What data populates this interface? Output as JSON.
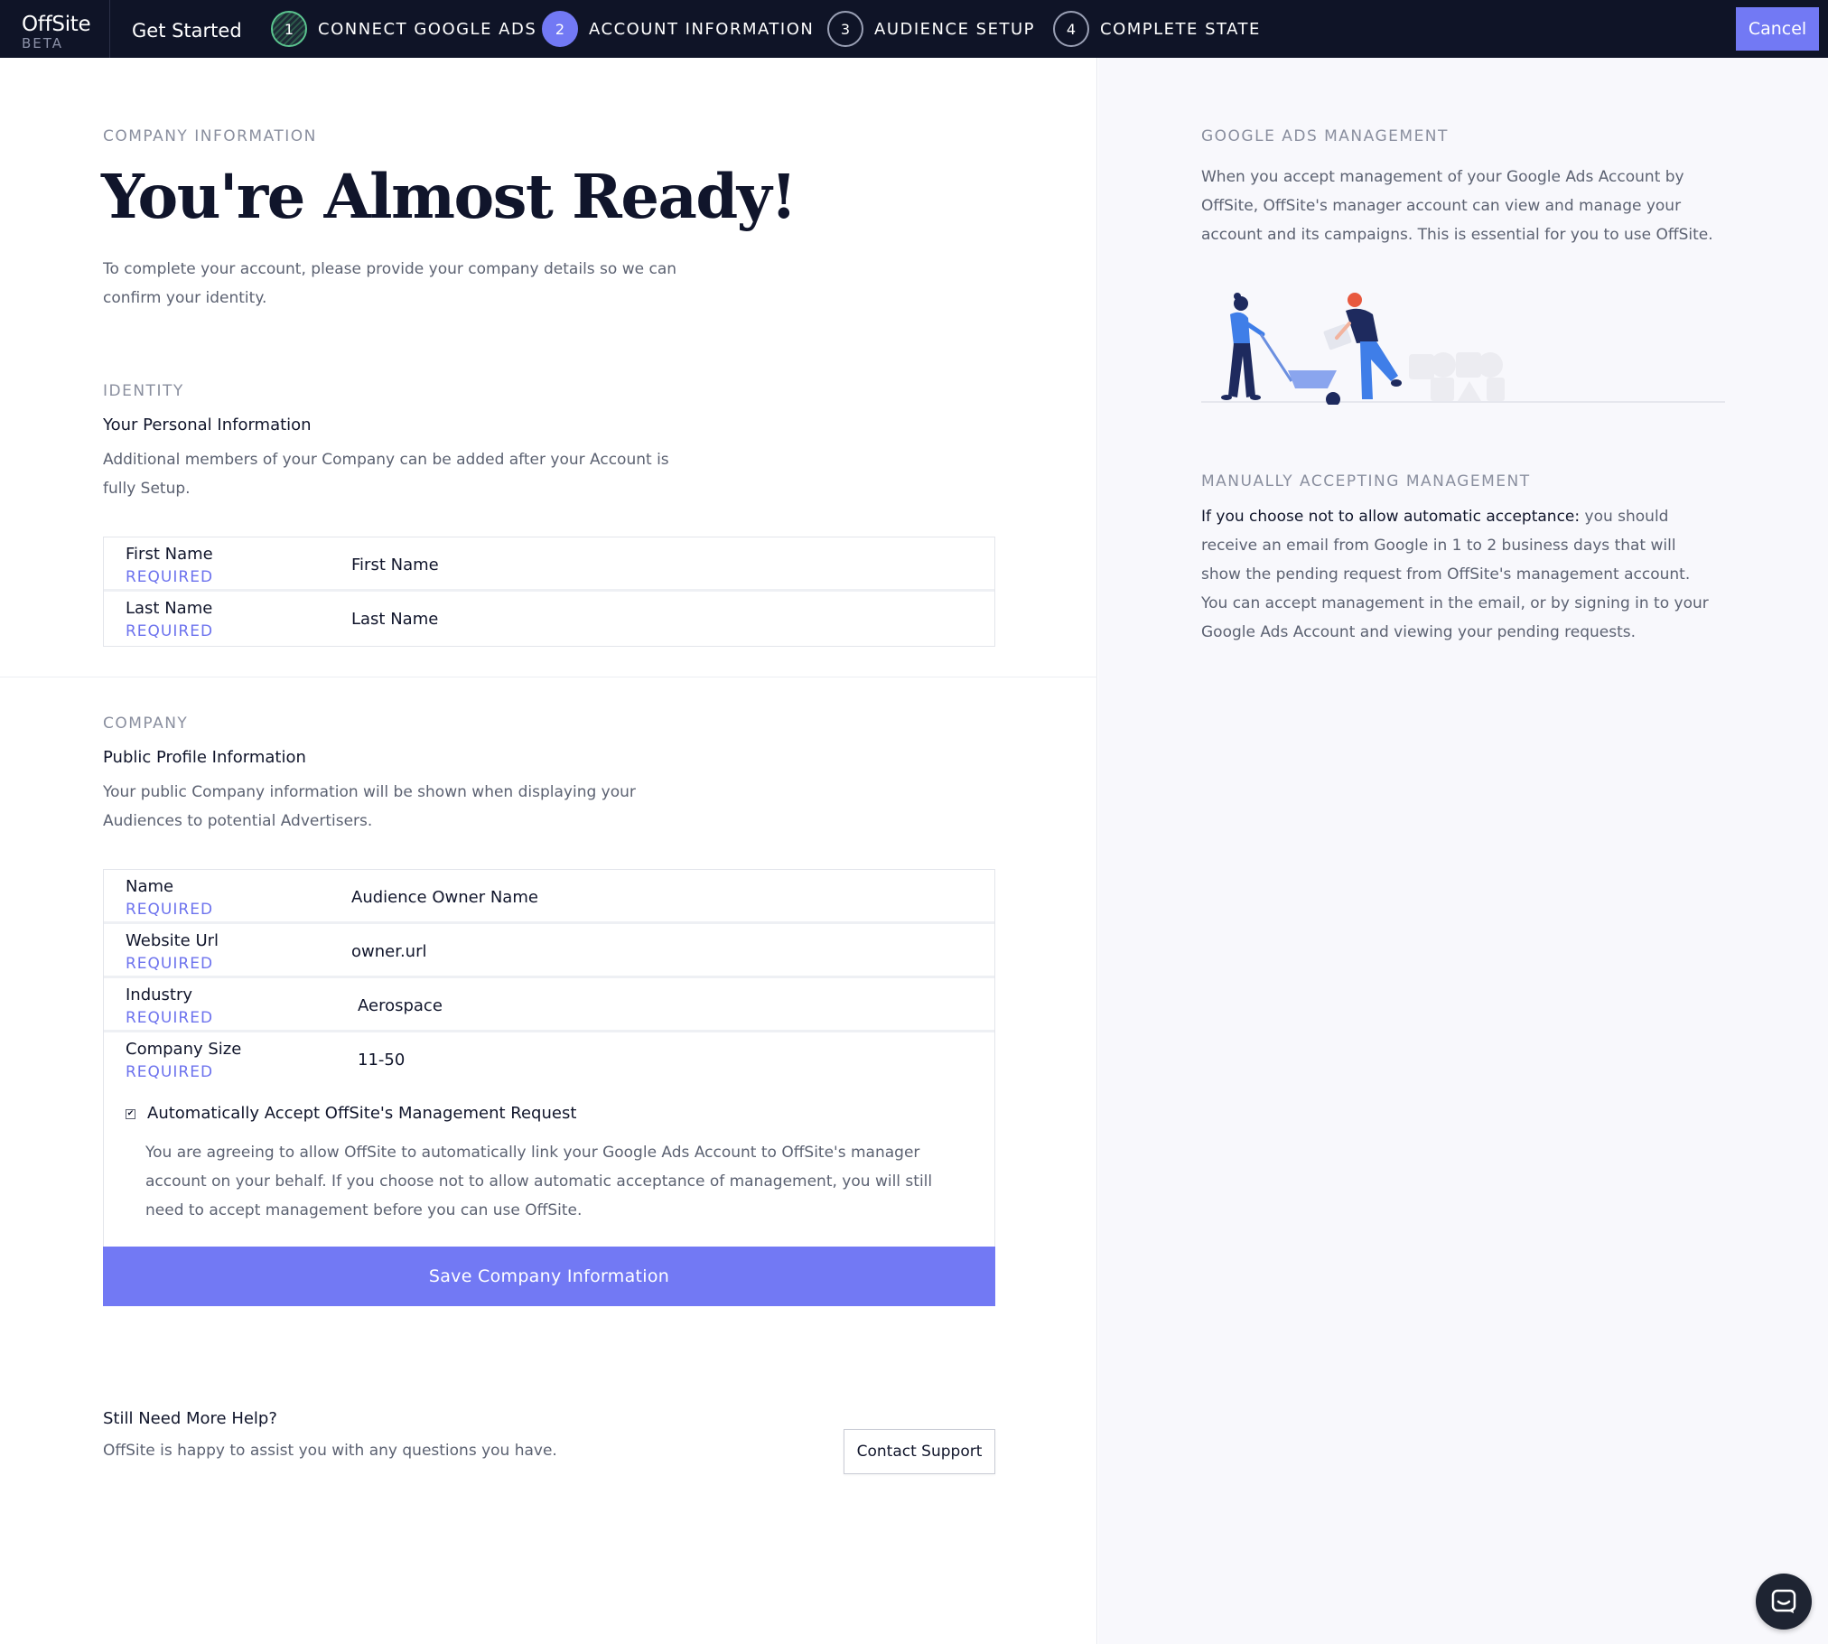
{
  "nav": {
    "brand": "OffSite",
    "beta": "BETA",
    "get_started": "Get Started",
    "steps": [
      {
        "number": "1",
        "label": "CONNECT GOOGLE ADS",
        "state": "complete"
      },
      {
        "number": "2",
        "label": "ACCOUNT INFORMATION",
        "state": "active"
      },
      {
        "number": "3",
        "label": "AUDIENCE SETUP",
        "state": "upcoming"
      },
      {
        "number": "4",
        "label": "COMPLETE STATE",
        "state": "upcoming"
      }
    ],
    "cancel": "Cancel"
  },
  "intro": {
    "eyebrow": "COMPANY INFORMATION",
    "title": "You're Almost Ready!",
    "description": "To complete your account, please provide your company details so we can confirm your identity."
  },
  "identity": {
    "eyebrow": "IDENTITY",
    "subhead": "Your Personal Information",
    "description": "Additional members of your Company can be added after your Account is fully Setup.",
    "fields": [
      {
        "label": "First Name",
        "required": "REQUIRED",
        "value": "First Name"
      },
      {
        "label": "Last Name",
        "required": "REQUIRED",
        "value": "Last Name"
      }
    ]
  },
  "company": {
    "eyebrow": "COMPANY",
    "subhead": "Public Profile Information",
    "description": "Your public Company information will be shown when displaying your Audiences to potential Advertisers.",
    "fields": [
      {
        "label": "Name",
        "required": "REQUIRED",
        "value": "Audience Owner Name"
      },
      {
        "label": "Website Url",
        "required": "REQUIRED",
        "value": "owner.url"
      },
      {
        "label": "Industry",
        "required": "REQUIRED",
        "value": "Aerospace"
      },
      {
        "label": "Company Size",
        "required": "REQUIRED",
        "value": "11-50"
      }
    ],
    "consent_checked": true,
    "consent_title": "Automatically Accept OffSite's Management Request",
    "consent_text": "You are agreeing to allow OffSite to automatically link your Google Ads Account to OffSite's manager account on your behalf. If you choose not to allow automatic acceptance of management, you will still need to accept management before you can use OffSite.",
    "save_label": "Save Company Information"
  },
  "help": {
    "title": "Still Need More Help?",
    "text": "OffSite is happy to assist you with any questions you have.",
    "contact_label": "Contact Support"
  },
  "sidebar": {
    "ads_eyebrow": "GOOGLE ADS MANAGEMENT",
    "ads_text": "When you accept management of your Google Ads Account by OffSite, OffSite's manager account can view and manage your account and its campaigns. This is essential for you to use OffSite.",
    "manual_eyebrow": "MANUALLY ACCEPTING MANAGEMENT",
    "manual_lead": "If you choose not to allow automatic acceptance:",
    "manual_text": " you should receive an email from Google in 1 to 2 business days that will show the pending request from OffSite's management account. You can accept management in the email, or by signing in to your Google Ads Account and viewing your pending requests."
  },
  "icons": {
    "chat": "chat-icon",
    "checkbox": "checkmark-icon"
  },
  "colors": {
    "nav_bg": "#0f1427",
    "accent": "#7279f4",
    "complete": "#5bc48f",
    "required": "#6d73ee"
  }
}
